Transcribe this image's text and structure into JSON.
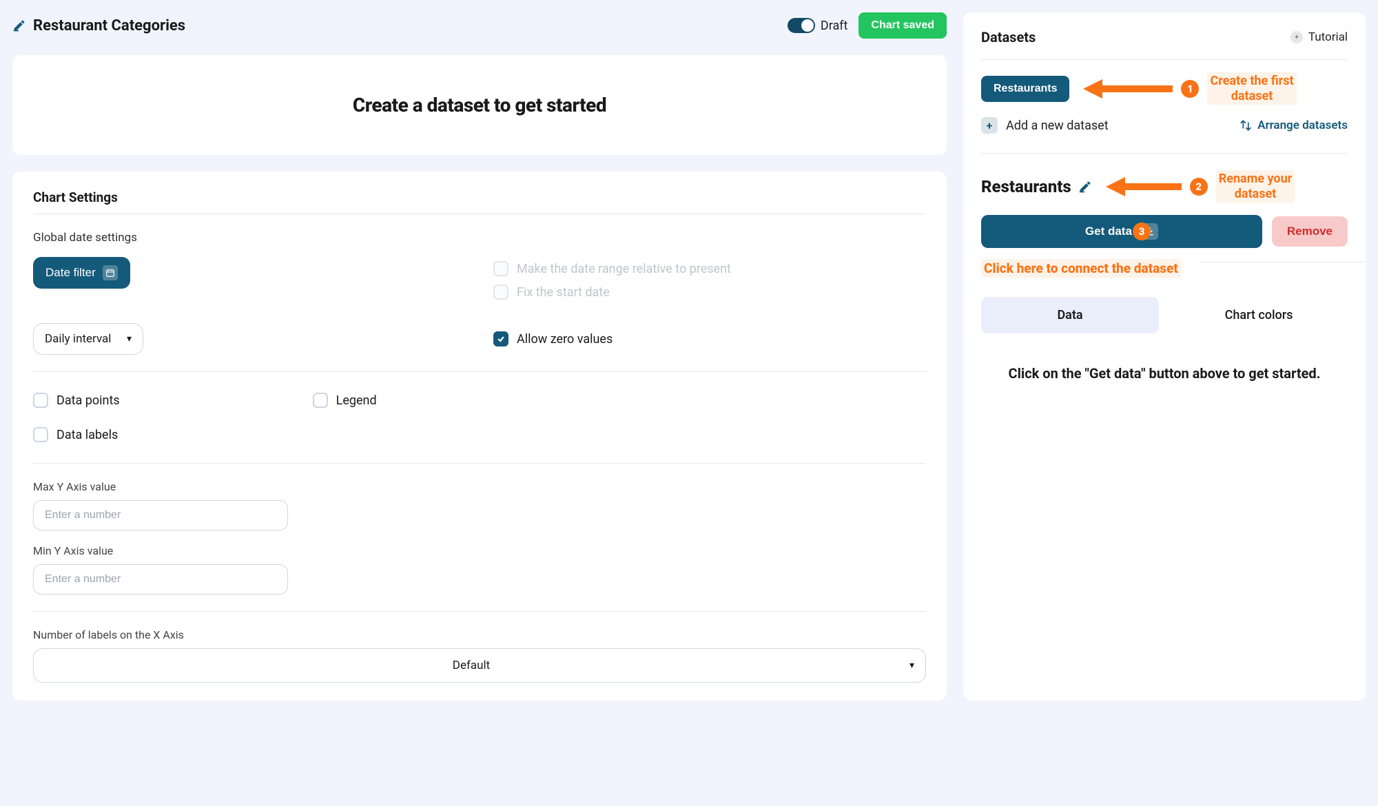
{
  "header": {
    "title": "Restaurant Categories",
    "draft_label": "Draft",
    "saved_label": "Chart saved"
  },
  "banner": "Create a dataset to get started",
  "settings": {
    "title": "Chart Settings",
    "global_date_label": "Global date settings",
    "date_filter_btn": "Date filter",
    "relative_label": "Make the date range relative to present",
    "fix_start_label": "Fix the start date",
    "interval_label": "Daily interval",
    "allow_zero_label": "Allow zero values",
    "data_points_label": "Data points",
    "data_labels_label": "Data labels",
    "legend_label": "Legend",
    "max_y_label": "Max Y Axis value",
    "min_y_label": "Min Y Axis value",
    "number_placeholder": "Enter a number",
    "xaxis_labels_label": "Number of labels on the X Axis",
    "xaxis_default": "Default"
  },
  "datasets": {
    "panel_title": "Datasets",
    "tutorial_label": "Tutorial",
    "chip_label": "Restaurants",
    "callout1": "Create the first\ndataset",
    "add_label": "Add a new dataset",
    "arrange_label": "Arrange datasets",
    "current_name": "Restaurants",
    "callout2": "Rename your\ndataset",
    "get_data_btn": "Get data",
    "remove_btn": "Remove",
    "connect_text": "Click here to connect the dataset",
    "tab_data": "Data",
    "tab_colors": "Chart colors",
    "empty_msg": "Click on the \"Get data\" button above to get started."
  }
}
